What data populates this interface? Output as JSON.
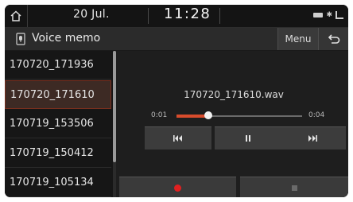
{
  "status": {
    "date": "20 Jul.",
    "time": "11:28"
  },
  "titlebar": {
    "title": "Voice memo",
    "menu_label": "Menu"
  },
  "list": {
    "items": [
      {
        "label": "170720_171936"
      },
      {
        "label": "170720_171610"
      },
      {
        "label": "170719_153506"
      },
      {
        "label": "170719_150412"
      },
      {
        "label": "170719_105134"
      }
    ],
    "selected_index": 1
  },
  "player": {
    "filename": "170720_171610.wav",
    "elapsed": "0:01",
    "duration": "0:04",
    "progress": 0.25
  },
  "colors": {
    "accent": "#d84c2c",
    "record": "#e02020",
    "selected_border": "#7a2f1e"
  }
}
